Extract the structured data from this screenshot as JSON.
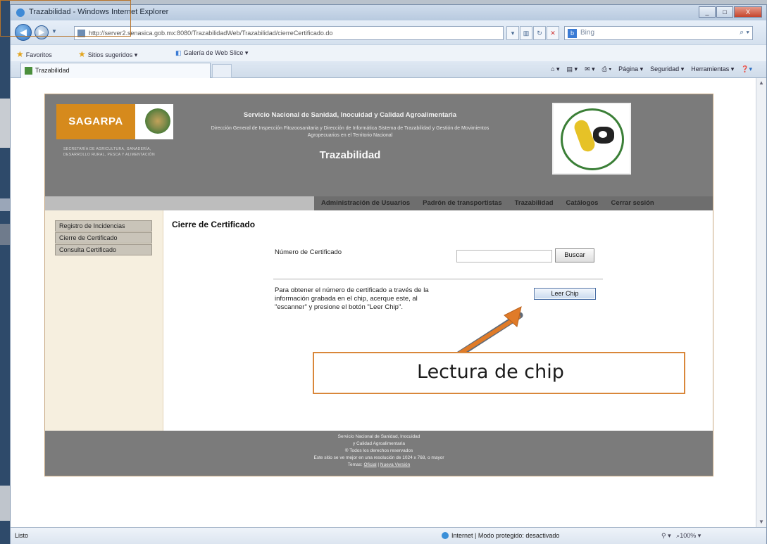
{
  "browser": {
    "title": "Trazabilidad - Windows Internet Explorer",
    "window_buttons": [
      "_",
      "□",
      "X"
    ],
    "url": "http://server2.senasica.gob.mx:8080/TrazabilidadWeb/Trazabilidad/cierreCertificado.do",
    "search_engine": "Bing",
    "favorites_bar": {
      "favorites_label": "Favoritos",
      "items": [
        "Sitios sugeridos ▾",
        "Galería de Web Slice ▾"
      ]
    },
    "tab_title": "Trazabilidad",
    "command_bar": [
      "Página ▾",
      "Seguridad ▾",
      "Herramientas ▾"
    ],
    "status_left": "Listo",
    "status_zone": "Internet | Modo protegido: desactivado",
    "zoom": "100%"
  },
  "header": {
    "logo_text": "SAGARPA",
    "secretaria": "SECRETARÍA DE AGRICULTURA, GANADERÍA, DESARROLLO RURAL, PESCA Y ALIMENTACIÓN",
    "agency": "Servicio Nacional de Sanidad, Inocuidad y Calidad Agroalimentaria",
    "subagency": "Dirección General de Inspección Fitozoosanitaria y Dirección de Informática Sistema de Trazabilidad y Gestión de Movimientos Agropecuarios en el Territorio Nacional",
    "app_title": "Trazabilidad"
  },
  "nav": {
    "items": [
      "Administración de Usuarios",
      "Padrón de transportistas",
      "Trazabilidad",
      "Catálogos",
      "Cerrar sesión"
    ]
  },
  "sidebar": {
    "items": [
      "Registro de Incidencias",
      "Cierre de Certificado",
      "Consulta Certificado"
    ]
  },
  "main": {
    "title": "Cierre de Certificado",
    "cert_label": "Número de Certificado",
    "cert_value": "",
    "search_button": "Buscar",
    "instructions": "Para obtener el número de certificado a través de la información grabada en el chip, acerque este, al \"escanner\" y presione el botón \"Leer Chip\".",
    "read_chip_button": "Leer Chip"
  },
  "footer": {
    "lines": [
      "Servicio Nacional de Sanidad, Inocuidad",
      "y Calidad Agroalimentaria",
      "® Todos los derechos reservados",
      "Este sitio se ve mejor en una resolución de 1024 x 768, o mayor"
    ],
    "links_prefix": "Temas:",
    "link1": "Oficial",
    "link2": "Nueva Versión"
  },
  "annotation": {
    "callout": "Lectura de chip"
  },
  "colors": {
    "header_gray": "#7b7b7b",
    "sagarpa_orange": "#d68a1c",
    "callout_border": "#d9873a",
    "arrow": "#e07b28"
  }
}
